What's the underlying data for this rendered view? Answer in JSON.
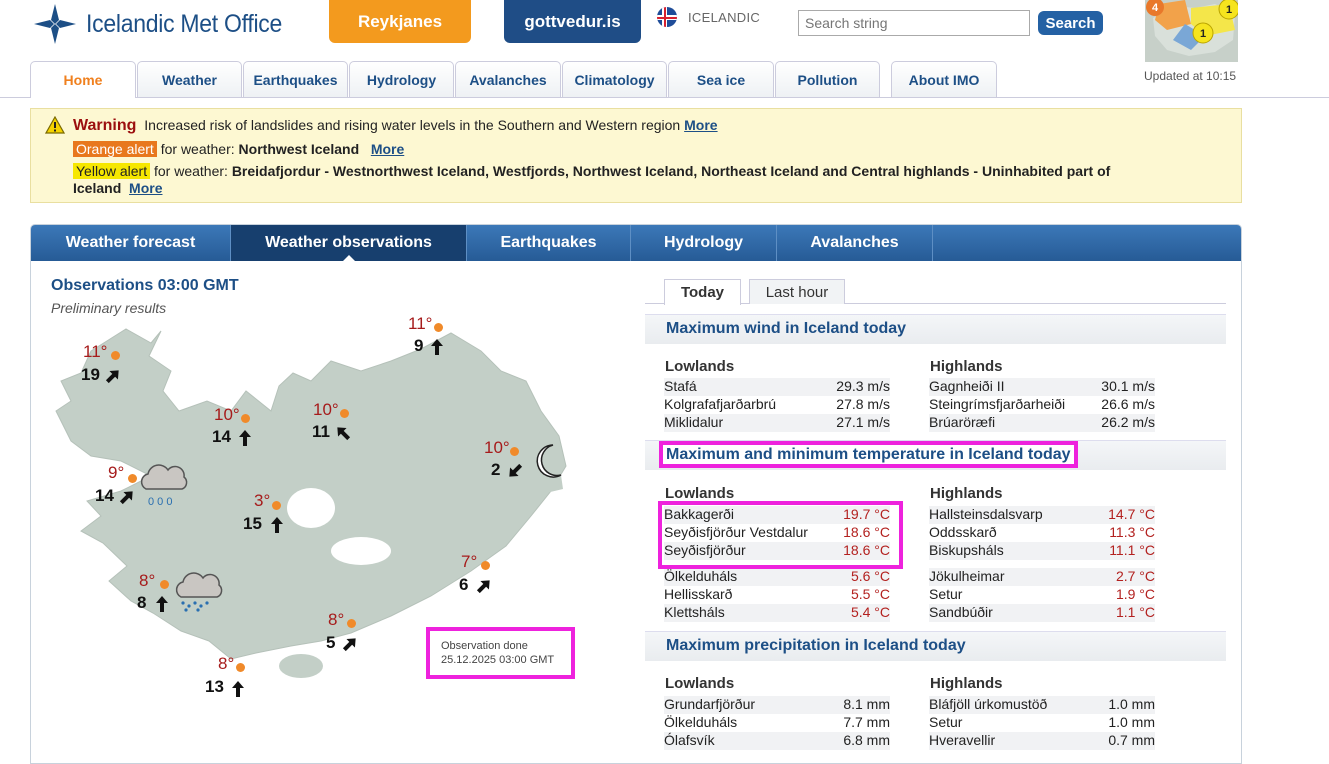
{
  "header": {
    "logo_text": "Icelandic Met Office",
    "reykjanes": "Reykjanes",
    "gottvedur": "gottvedur.is",
    "language": "ICELANDIC",
    "search_placeholder": "Search string",
    "search_button": "Search",
    "updated": "Updated at 10:15",
    "mini_map_badges": [
      "4",
      "1",
      "1"
    ]
  },
  "nav": [
    "Home",
    "Weather",
    "Earthquakes",
    "Hydrology",
    "Avalanches",
    "Climatology",
    "Sea ice",
    "Pollution",
    "About IMO"
  ],
  "warning": {
    "title": "Warning",
    "text": "Increased risk of landslides and rising water levels in the Southern and Western region",
    "more": "More",
    "orange_label": "Orange alert",
    "orange_for": "for weather:",
    "orange_region": "Northwest Iceland",
    "yellow_label": "Yellow alert",
    "yellow_for": "for weather:",
    "yellow_region_1": "Breidafjordur - Westnorthwest Iceland, Westfjords, Northwest Iceland, Northeast Iceland and Central highlands - Uninhabited part of",
    "yellow_region_2": "Iceland"
  },
  "panel_tabs": [
    "Weather forecast",
    "Weather observations",
    "Earthquakes",
    "Hydrology",
    "Avalanches"
  ],
  "observations": {
    "title": "Observations 03:00 GMT",
    "subtitle": "Preliminary results",
    "box_line1": "Observation done",
    "box_line2": "25.12.2025 03:00 GMT",
    "stations": [
      {
        "temp": "11°",
        "wind": "19"
      },
      {
        "temp": "11°",
        "wind": "9"
      },
      {
        "temp": "10°",
        "wind": "14"
      },
      {
        "temp": "10°",
        "wind": "11"
      },
      {
        "temp": "10°",
        "wind": "2"
      },
      {
        "temp": "9°",
        "wind": "14"
      },
      {
        "temp": "3°",
        "wind": "15"
      },
      {
        "temp": "7°",
        "wind": "6"
      },
      {
        "temp": "8°",
        "wind": "8"
      },
      {
        "temp": "8°",
        "wind": "5"
      },
      {
        "temp": "8°",
        "wind": "13"
      }
    ]
  },
  "right": {
    "tabs": [
      "Today",
      "Last hour"
    ],
    "wind_title": "Maximum wind in Iceland today",
    "temp_title": "Maximum and minimum temperature in Iceland today",
    "precip_title": "Maximum precipitation in Iceland today",
    "lowlands": "Lowlands",
    "highlands": "Highlands",
    "wind_low": [
      [
        "Stafá",
        "29.3 m/s"
      ],
      [
        "Kolgrafafjarðarbrú",
        "27.8 m/s"
      ],
      [
        "Miklidalur",
        "27.1 m/s"
      ]
    ],
    "wind_high": [
      [
        "Gagnheiði II",
        "30.1 m/s"
      ],
      [
        "Steingrímsfjarðarheiði",
        "26.6 m/s"
      ],
      [
        "Brúaröræfi",
        "26.2 m/s"
      ]
    ],
    "tmax_low": [
      [
        "Bakkagerði",
        "19.7 °C"
      ],
      [
        "Seyðisfjörður Vestdalur",
        "18.6 °C"
      ],
      [
        "Seyðisfjörður",
        "18.6 °C"
      ]
    ],
    "tmax_high": [
      [
        "Hallsteinsdalsvarp",
        "14.7 °C"
      ],
      [
        "Oddsskarð",
        "11.3 °C"
      ],
      [
        "Biskupsháls",
        "11.1 °C"
      ]
    ],
    "tmin_low": [
      [
        "Ölkelduháls",
        "5.6 °C"
      ],
      [
        "Hellisskarð",
        "5.5 °C"
      ],
      [
        "Klettsháls",
        "5.4 °C"
      ]
    ],
    "tmin_high": [
      [
        "Jökulheimar",
        "2.7 °C"
      ],
      [
        "Setur",
        "1.9 °C"
      ],
      [
        "Sandbúðir",
        "1.1 °C"
      ]
    ],
    "prec_low": [
      [
        "Grundarfjörður",
        "8.1 mm"
      ],
      [
        "Ölkelduháls",
        "7.7 mm"
      ],
      [
        "Ólafsvík",
        "6.8 mm"
      ]
    ],
    "prec_high": [
      [
        "Bláfjöll úrkomustöð",
        "1.0 mm"
      ],
      [
        "Setur",
        "1.0 mm"
      ],
      [
        "Hveravellir",
        "0.7 mm"
      ]
    ]
  }
}
